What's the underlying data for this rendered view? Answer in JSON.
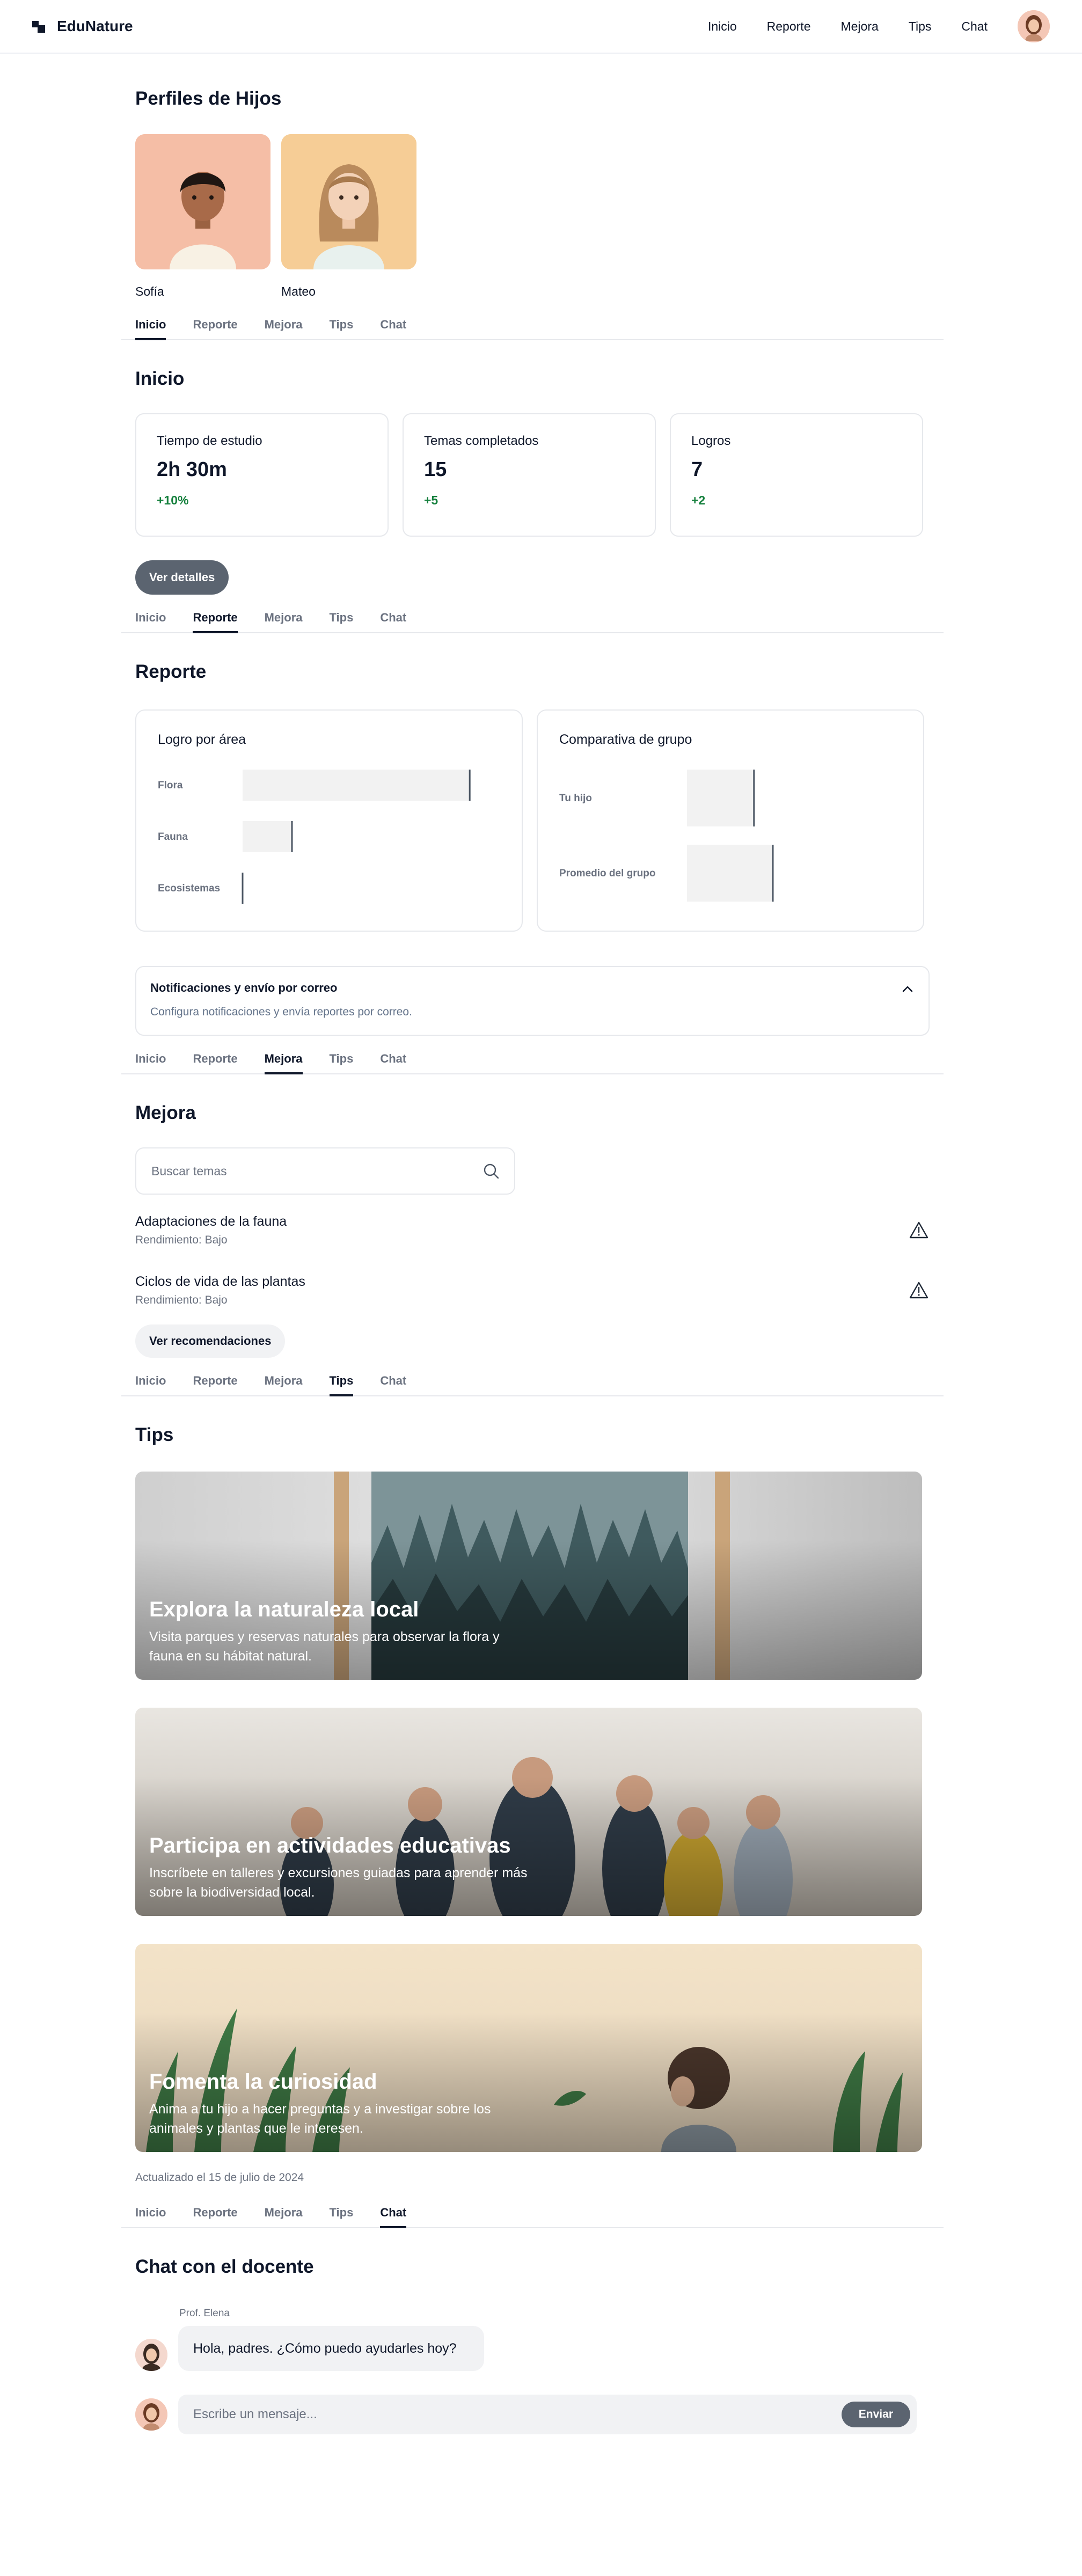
{
  "app": {
    "brand": "EduNature",
    "nav": [
      "Inicio",
      "Reporte",
      "Mejora",
      "Tips",
      "Chat"
    ]
  },
  "profiles": {
    "title": "Perfiles de Hijos",
    "items": [
      {
        "name": "Sofía"
      },
      {
        "name": "Mateo"
      }
    ]
  },
  "tabs": [
    "Inicio",
    "Reporte",
    "Mejora",
    "Tips",
    "Chat"
  ],
  "inicio": {
    "title": "Inicio",
    "stats": [
      {
        "label": "Tiempo de estudio",
        "value": "2h 30m",
        "change": "+10%"
      },
      {
        "label": "Temas completados",
        "value": "15",
        "change": "+5"
      },
      {
        "label": "Logros",
        "value": "7",
        "change": "+2"
      }
    ],
    "details_button": "Ver detalles"
  },
  "reporte": {
    "title": "Reporte",
    "card_area_title": "Logro por área",
    "card_group_title": "Comparativa de grupo",
    "notifications": {
      "title": "Notificaciones y envío por correo",
      "description": "Configura notificaciones y envía reportes por correo."
    }
  },
  "chart_data": [
    {
      "type": "bar",
      "title": "Logro por área",
      "categories": [
        "Flora",
        "Fauna",
        "Ecosistemas"
      ],
      "values": [
        0.92,
        0.2,
        0.0
      ],
      "xlim": [
        0,
        1
      ]
    },
    {
      "type": "bar",
      "title": "Comparativa de grupo",
      "categories": [
        "Tu hijo",
        "Promedio del grupo"
      ],
      "values": [
        0.78,
        1.0
      ],
      "xlim": [
        0,
        1
      ]
    }
  ],
  "mejora": {
    "title": "Mejora",
    "search_placeholder": "Buscar temas",
    "topics": [
      {
        "title": "Adaptaciones de la fauna",
        "status": "Rendimiento: Bajo"
      },
      {
        "title": "Ciclos de vida de las plantas",
        "status": "Rendimiento: Bajo"
      }
    ],
    "recommendations_button": "Ver recomendaciones"
  },
  "tips": {
    "title": "Tips",
    "items": [
      {
        "title": "Explora la naturaleza local",
        "description": "Visita parques y reservas naturales para observar la flora y fauna en su hábitat natural."
      },
      {
        "title": "Participa en actividades educativas",
        "description": "Inscríbete en talleres y excursiones guiadas para aprender más sobre la biodiversidad local."
      },
      {
        "title": "Fomenta la curiosidad",
        "description": "Anima a tu hijo a hacer preguntas y a investigar sobre los animales y plantas que le interesen."
      }
    ],
    "updated": "Actualizado el 15 de julio de 2024"
  },
  "chat": {
    "title": "Chat con el docente",
    "sender": "Prof. Elena",
    "message": "Hola, padres. ¿Cómo puedo ayudarles hoy?",
    "input_placeholder": "Escribe un mensaje...",
    "send_label": "Enviar"
  },
  "colors": {
    "accent": "#5b6470",
    "positive": "#15803d",
    "border": "#e6e8ec"
  }
}
